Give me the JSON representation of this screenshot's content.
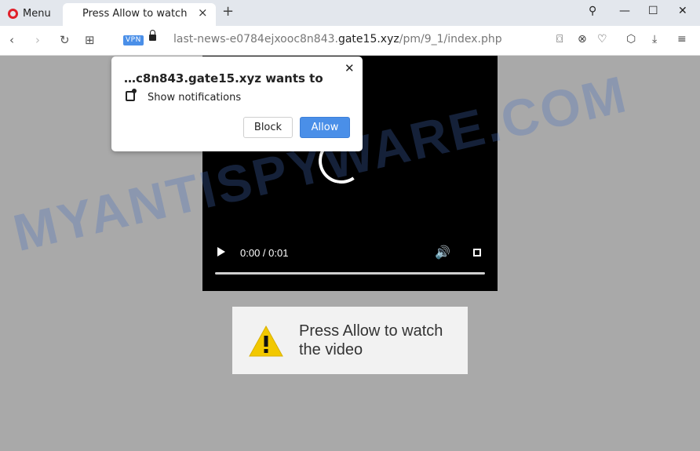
{
  "tabbar": {
    "menu_label": "Menu",
    "tab_title": "Press Allow to watch",
    "tab_close": "×",
    "new_tab": "+",
    "search_glyph": "⚲",
    "min_glyph": "—",
    "max_glyph": "☐",
    "close_glyph": "✕"
  },
  "addressbar": {
    "back_glyph": "‹",
    "forward_glyph": "›",
    "reload_glyph": "↻",
    "grid_glyph": "⊞",
    "vpn_label": "VPN",
    "url_prefix": "last-news-e0784ejxooc8n843.",
    "url_domain": "gate15.xyz",
    "url_path": "/pm/9_1/index.php",
    "camera_glyph": "⌼",
    "xcircle_glyph": "⊗",
    "heart_glyph": "♡",
    "cube_glyph": "⬡",
    "download_glyph": "⤓",
    "settings_glyph": "≡"
  },
  "video": {
    "time": "0:00 / 0:01",
    "volume_glyph": "🔊",
    "progress": 0
  },
  "message": {
    "text": "Press Allow to watch the video"
  },
  "popup": {
    "title": "…c8n843.gate15.xyz wants to",
    "close_glyph": "✕",
    "permission": "Show notifications",
    "block_label": "Block",
    "allow_label": "Allow"
  },
  "watermark": "MYANTISPYWARE.COM",
  "colors": {
    "accent": "#4a8fe8",
    "opera_red": "#e0202a",
    "page_bg": "#a9a9a9"
  }
}
